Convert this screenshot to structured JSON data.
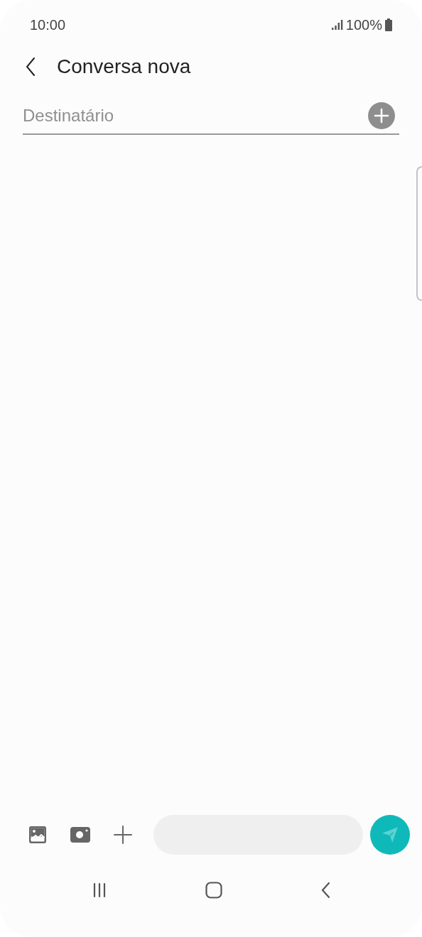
{
  "status_bar": {
    "time": "10:00",
    "battery": "100%"
  },
  "header": {
    "title": "Conversa nova"
  },
  "recipient": {
    "placeholder": "Destinatário"
  }
}
